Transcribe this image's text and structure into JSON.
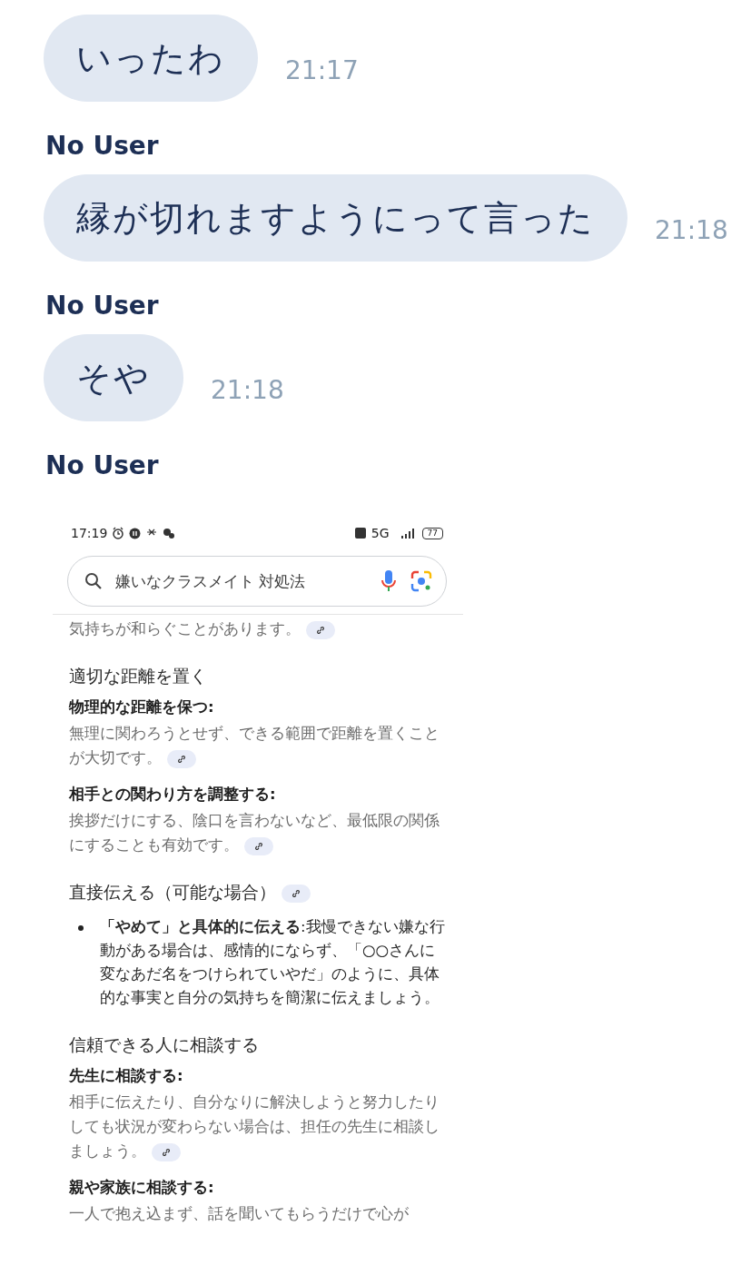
{
  "messages": [
    {
      "text": "いったわ",
      "time": "21:17"
    },
    {
      "sender": "No User",
      "text": "縁が切れますようにって言った",
      "time": "21:18"
    },
    {
      "sender": "No User",
      "text": "そや",
      "time": "21:18"
    },
    {
      "sender": "No User",
      "kind": "screenshot",
      "screenshot": {
        "status_time": "17:19",
        "battery_level_text": "77",
        "network": "5G",
        "search_query": "嫌いなクラスメイト 対処法",
        "blocks": [
          {
            "kind": "paragraph",
            "text": "気持ちが和らぐことがあります。",
            "link": true
          },
          {
            "kind": "heading",
            "text": "適切な距離を置く",
            "link": false
          },
          {
            "kind": "subheading",
            "text": "物理的な距離を保つ:"
          },
          {
            "kind": "paragraph",
            "text": "無理に関わろうとせず、できる範囲で距離を置くことが大切です。",
            "link": true
          },
          {
            "kind": "subheading",
            "text": "相手との関わり方を調整する:"
          },
          {
            "kind": "paragraph",
            "text": "挨拶だけにする、陰口を言わないなど、最低限の関係にすることも有効です。",
            "link": true
          },
          {
            "kind": "heading",
            "text": "直接伝える（可能な場合）",
            "link": true
          },
          {
            "kind": "bullet",
            "text": "**「やめて」と具体的に伝える**:我慢できない嫌な行動がある場合は、感情的にならず、「○○さんに変なあだ名をつけられていやだ」のように、具体的な事実と自分の気持ちを簡潔に伝えましょう。"
          },
          {
            "kind": "heading",
            "text": "信頼できる人に相談する",
            "link": false
          },
          {
            "kind": "subheading",
            "text": "先生に相談する:"
          },
          {
            "kind": "paragraph",
            "text": "相手に伝えたり、自分なりに解決しようと努力したりしても状況が変わらない場合は、担任の先生に相談しましょう。",
            "link": true
          },
          {
            "kind": "subheading",
            "text": "親や家族に相談する:"
          },
          {
            "kind": "paragraph",
            "text": "一人で抱え込まず、話を聞いてもらうだけで心が",
            "link": false
          }
        ]
      }
    }
  ]
}
